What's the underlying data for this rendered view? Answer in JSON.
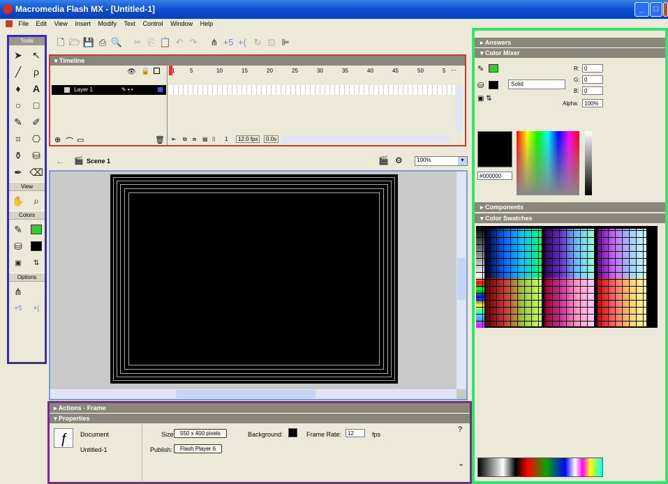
{
  "window": {
    "title": "Macromedia Flash MX - [Untitled-1]",
    "min": "_",
    "max": "□",
    "close": "×"
  },
  "menu": [
    "File",
    "Edit",
    "View",
    "Insert",
    "Modify",
    "Text",
    "Control",
    "Window",
    "Help"
  ],
  "tools": {
    "title": "Tools",
    "sections": {
      "view": "View",
      "colors": "Colors",
      "options": "Options"
    },
    "stroke_color": "#33cc33",
    "fill_color": "#000000"
  },
  "timeline": {
    "title": "Timeline",
    "layer_name": "Layer 1",
    "frame_numbers": [
      "1",
      "5",
      "10",
      "15",
      "20",
      "25",
      "30",
      "35",
      "40",
      "45",
      "50",
      "5"
    ],
    "status": {
      "frame": "1",
      "fps": "12.0 fps",
      "time": "0.0s"
    }
  },
  "editbar": {
    "scene": "Scene 1",
    "zoom": "100%"
  },
  "stage": {
    "background": "#000000"
  },
  "panels": {
    "actions_title": "Actions - Frame",
    "properties_title": "Properties",
    "document_label": "Document",
    "document_name": "Untitled-1",
    "size_label": "Size:",
    "size_value": "550 x 400 pixels",
    "publish_label": "Publish:",
    "publish_value": "Flash Player 6",
    "background_label": "Background:",
    "framerate_label": "Frame Rate:",
    "framerate_value": "12",
    "fps_unit": "fps"
  },
  "right": {
    "answers": "Answers",
    "color_mixer": "Color Mixer",
    "fill_style": "Solid",
    "r_label": "R:",
    "r": "0",
    "g_label": "G:",
    "g": "0",
    "b_label": "B:",
    "b": "0",
    "alpha_label": "Alpha:",
    "alpha": "100%",
    "hex": "#000000",
    "components": "Components",
    "color_swatches": "Color Swatches"
  }
}
